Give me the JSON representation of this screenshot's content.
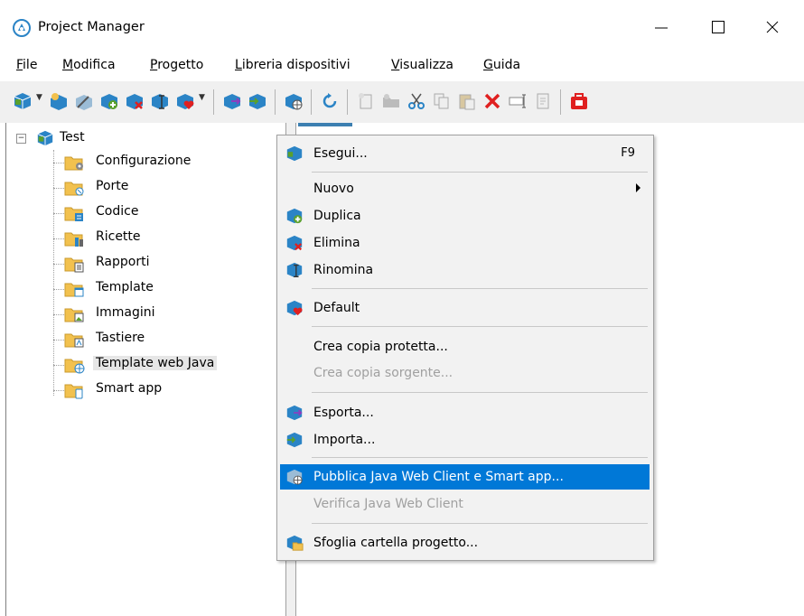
{
  "window": {
    "title": "Project Manager"
  },
  "menubar": [
    {
      "label": "File",
      "mnemonic": "F",
      "rest": "ile"
    },
    {
      "label": "Modifica",
      "mnemonic": "M",
      "rest": "odifica"
    },
    {
      "label": "Progetto",
      "mnemonic": "P",
      "rest": "rogetto"
    },
    {
      "label": "Libreria dispositivi",
      "mnemonic": "L",
      "rest": "ibreria dispositivi"
    },
    {
      "label": "Visualizza",
      "mnemonic": "V",
      "rest": "isualizza"
    },
    {
      "label": "Guida",
      "mnemonic": "G",
      "rest": "uida"
    }
  ],
  "tree": {
    "root": "Test",
    "items": [
      {
        "label": "Configurazione",
        "icon": "folder-gear-icon"
      },
      {
        "label": "Porte",
        "icon": "folder-port-icon"
      },
      {
        "label": "Codice",
        "icon": "folder-code-icon"
      },
      {
        "label": "Ricette",
        "icon": "folder-recipe-icon"
      },
      {
        "label": "Rapporti",
        "icon": "folder-report-icon"
      },
      {
        "label": "Template",
        "icon": "folder-template-icon"
      },
      {
        "label": "Immagini",
        "icon": "folder-image-icon"
      },
      {
        "label": "Tastiere",
        "icon": "folder-keyboard-icon"
      },
      {
        "label": "Template web Java",
        "icon": "folder-web-icon",
        "selected": true
      },
      {
        "label": "Smart app",
        "icon": "folder-smartapp-icon"
      }
    ]
  },
  "context_menu": {
    "items": [
      {
        "label": "Esegui...",
        "shortcut": "F9",
        "icon": "run-project-icon"
      },
      {
        "label": "Nuovo",
        "submenu": true
      },
      {
        "label": "Duplica",
        "icon": "duplicate-icon"
      },
      {
        "label": "Elimina",
        "icon": "delete-project-icon"
      },
      {
        "label": "Rinomina",
        "icon": "rename-icon"
      },
      {
        "label": "Default",
        "icon": "default-heart-icon"
      },
      {
        "label": "Crea copia protetta..."
      },
      {
        "label": "Crea copia sorgente...",
        "disabled": true
      },
      {
        "label": "Esporta...",
        "icon": "export-icon"
      },
      {
        "label": "Importa...",
        "icon": "import-icon"
      },
      {
        "label": "Pubblica Java Web Client e Smart app...",
        "icon": "publish-web-icon",
        "highlighted": true
      },
      {
        "label": "Verifica Java Web Client",
        "disabled": true
      },
      {
        "label": "Sfoglia cartella progetto...",
        "icon": "browse-folder-icon"
      }
    ]
  },
  "colors": {
    "highlight": "#0078d7",
    "toolbar_bg": "#f0f0f0",
    "menu_bg": "#f2f2f2",
    "cube_blue": "#2b84c6",
    "cube_green": "#5aa02c",
    "delete_red": "#e02020",
    "folder_yellow": "#f2c14e"
  }
}
